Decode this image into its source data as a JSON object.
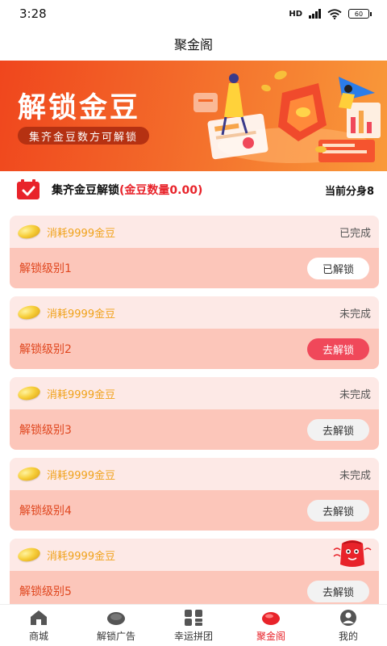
{
  "status_bar": {
    "time": "3:28",
    "network": "HD",
    "battery": "60"
  },
  "nav": {
    "title": "聚金阁"
  },
  "banner": {
    "title": "解锁金豆",
    "subtitle": "集齐金豆数方可解锁"
  },
  "summary": {
    "title": "集齐金豆解锁",
    "count_text": "(金豆数量0.00)",
    "right_text": "当前分身8"
  },
  "levels": [
    {
      "cost": "消耗9999金豆",
      "status": "已完成",
      "label": "解锁级别1",
      "button": "已解锁"
    },
    {
      "cost": "消耗9999金豆",
      "status": "未完成",
      "label": "解锁级别2",
      "button": "去解锁"
    },
    {
      "cost": "消耗9999金豆",
      "status": "未完成",
      "label": "解锁级别3",
      "button": "去解锁"
    },
    {
      "cost": "消耗9999金豆",
      "status": "未完成",
      "label": "解锁级别4",
      "button": "去解锁"
    },
    {
      "cost": "消耗9999金豆",
      "status": "",
      "label": "解锁级别5",
      "button": "去解锁"
    }
  ],
  "tabs": [
    {
      "label": "商城",
      "icon": "home-icon"
    },
    {
      "label": "解锁广告",
      "icon": "bean-icon"
    },
    {
      "label": "幸运拼团",
      "icon": "grid-icon"
    },
    {
      "label": "聚金阁",
      "icon": "gold-bean-icon"
    },
    {
      "label": "我的",
      "icon": "user-icon"
    }
  ],
  "colors": {
    "accent": "#e8232a",
    "banner_start": "#f0461d",
    "banner_end": "#f99a3a",
    "card_top": "#fde9e6",
    "card_bottom": "#fcc6ba",
    "cta": "#f0485a"
  }
}
